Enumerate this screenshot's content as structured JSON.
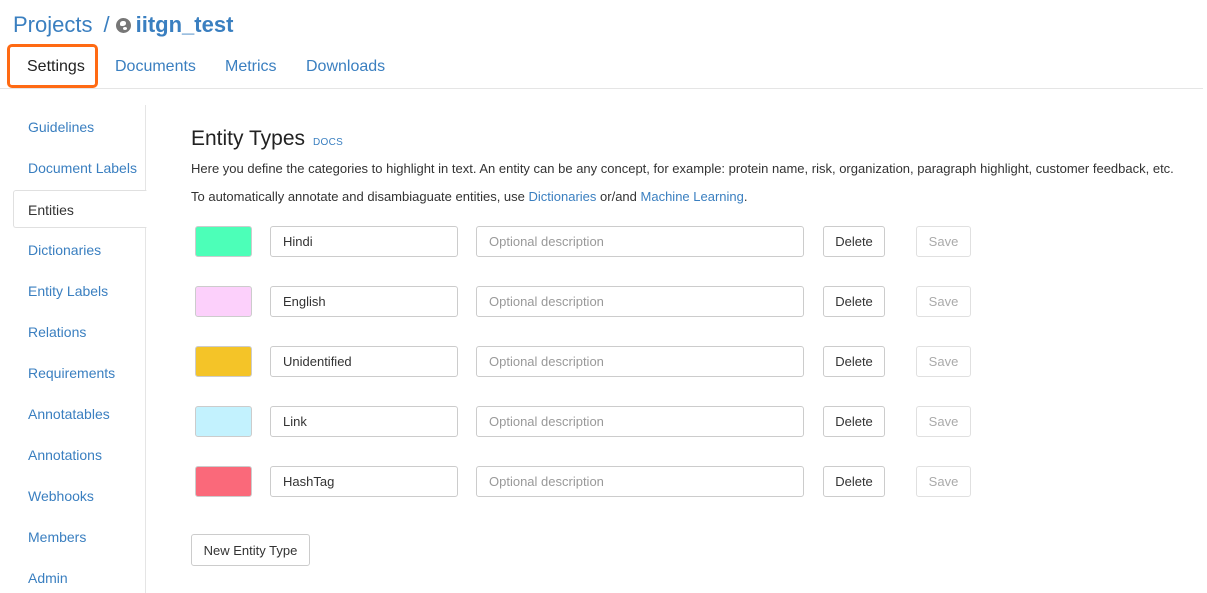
{
  "breadcrumb": {
    "root": "Projects",
    "separator": "/",
    "project": "iitgn_test"
  },
  "top_tabs": [
    "Settings",
    "Documents",
    "Metrics",
    "Downloads"
  ],
  "sidebar": {
    "items": [
      "Guidelines",
      "Document Labels",
      "Entities",
      "Dictionaries",
      "Entity Labels",
      "Relations",
      "Requirements",
      "Annotatables",
      "Annotations",
      "Webhooks",
      "Members",
      "Admin"
    ],
    "active": "Entities"
  },
  "main": {
    "title": "Entity Types",
    "docs_label": "DOCS",
    "description": "Here you define the categories to highlight in text. An entity can be any concept, for example: protein name, risk, organization, paragraph highlight, customer feedback, etc.",
    "auto_text_1": "To automatically annotate and disambiaguate entities, use ",
    "auto_link_1": "Dictionaries",
    "auto_text_2": " or/and ",
    "auto_link_2": "Machine Learning",
    "auto_text_3": ".",
    "description_placeholder": "Optional description",
    "delete_label": "Delete",
    "save_label": "Save",
    "new_button": "New Entity Type"
  },
  "entities": [
    {
      "name": "Hindi",
      "color": "#4cffb8"
    },
    {
      "name": "English",
      "color": "#fcd0fb"
    },
    {
      "name": "Unidentified",
      "color": "#f4c428"
    },
    {
      "name": "Link",
      "color": "#c3f2fe"
    },
    {
      "name": "HashTag",
      "color": "#fa697a"
    }
  ],
  "colors": {
    "link": "#3a7fc0",
    "highlight": "#ff6a13"
  }
}
